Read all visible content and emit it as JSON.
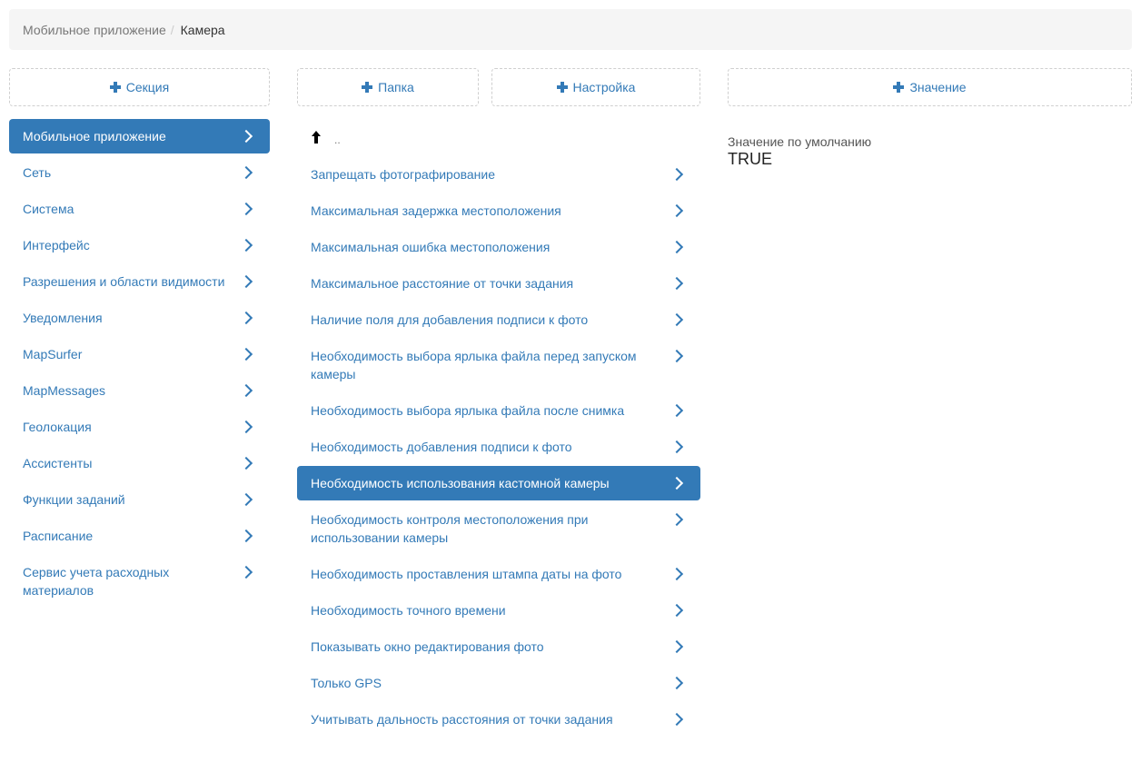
{
  "breadcrumb": {
    "parent": "Мобильное приложение",
    "separator": "/",
    "current": "Камера"
  },
  "buttons": {
    "section": "Секция",
    "folder": "Папка",
    "setting": "Настройка",
    "value": "Значение"
  },
  "sections": [
    {
      "label": "Мобильное приложение",
      "active": true
    },
    {
      "label": "Сеть"
    },
    {
      "label": "Система"
    },
    {
      "label": "Интерфейс"
    },
    {
      "label": "Разрешения и области видимости"
    },
    {
      "label": "Уведомления"
    },
    {
      "label": "MapSurfer"
    },
    {
      "label": "MapMessages"
    },
    {
      "label": "Геолокация"
    },
    {
      "label": "Ассистенты"
    },
    {
      "label": "Функции заданий"
    },
    {
      "label": "Расписание"
    },
    {
      "label": "Сервис учета расходных материалов"
    }
  ],
  "settings": {
    "up_label": "..",
    "items": [
      {
        "label": "Запрещать фотографирование"
      },
      {
        "label": "Максимальная задержка местоположения"
      },
      {
        "label": "Максимальная ошибка местоположения"
      },
      {
        "label": "Максимальное расстояние от точки задания"
      },
      {
        "label": "Наличие поля для добавления подписи к фото"
      },
      {
        "label": "Необходимость выбора ярлыка файла перед запуском камеры"
      },
      {
        "label": "Необходимость выбора ярлыка файла после снимка"
      },
      {
        "label": "Необходимость добавления подписи к фото"
      },
      {
        "label": "Необходимость использования кастомной камеры",
        "active": true
      },
      {
        "label": "Необходимость контроля местоположения при использовании камеры"
      },
      {
        "label": "Необходимость проставления штампа даты на фото"
      },
      {
        "label": "Необходимость точного времени"
      },
      {
        "label": "Показывать окно редактирования фото"
      },
      {
        "label": "Только GPS"
      },
      {
        "label": "Учитывать дальность расстояния от точки задания"
      }
    ]
  },
  "value_panel": {
    "label": "Значение по умолчанию",
    "value": "TRUE"
  },
  "colors": {
    "accent": "#337ab7",
    "breadcrumb_bg": "#f5f5f5"
  }
}
